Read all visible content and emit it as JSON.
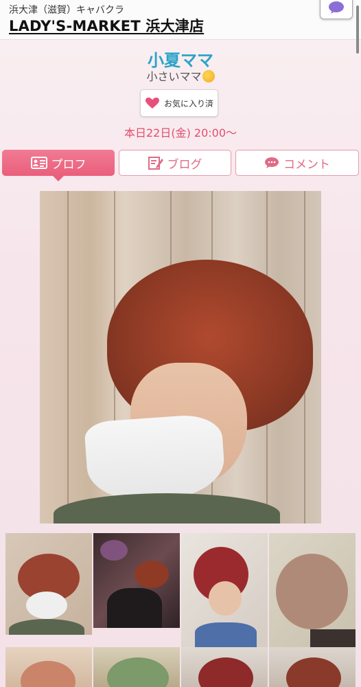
{
  "header": {
    "area_genre": "浜大津（滋賀）キャバクラ",
    "shop_name": "LADY'S-MARKET 浜大津店"
  },
  "profile": {
    "name": "小夏ママ",
    "catchphrase": "小さいママ",
    "favorite_label": "お気に入り済",
    "schedule": "本日22日(金) 20:00～"
  },
  "tabs": [
    {
      "label": "プロフ",
      "icon": "profile-card-icon",
      "active": true
    },
    {
      "label": "ブログ",
      "icon": "pencil-note-icon",
      "active": false
    },
    {
      "label": "コメント",
      "icon": "speech-bubble-icon",
      "active": false
    }
  ],
  "colors": {
    "accent_pink": "#ea5f7c",
    "name_blue": "#2aa3c8",
    "schedule_red": "#e24e6e",
    "chat_purple": "#8a6fd6"
  },
  "gallery": {
    "main_photo": "cast-main-photo",
    "thumbnails": 8
  }
}
